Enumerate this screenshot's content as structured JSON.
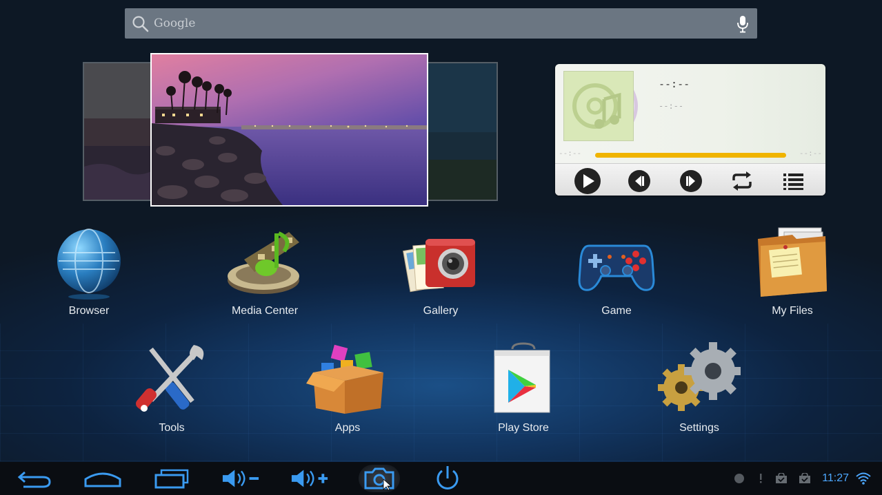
{
  "search": {
    "placeholder": "Google"
  },
  "music": {
    "title": "--:--",
    "artist": "--:--",
    "time_elapsed": "--:--",
    "time_total": "--:--",
    "progress_percent": 100
  },
  "apps": [
    {
      "label": "Browser"
    },
    {
      "label": "Media Center"
    },
    {
      "label": "Gallery"
    },
    {
      "label": "Game"
    },
    {
      "label": "My Files"
    },
    {
      "label": "Tools"
    },
    {
      "label": "Apps"
    },
    {
      "label": "Play Store"
    },
    {
      "label": "Settings"
    }
  ],
  "status": {
    "time": "11:27"
  },
  "colors": {
    "accent": "#4da8ff",
    "progress": "#f0b400",
    "nav_bg": "#0a0d12"
  }
}
